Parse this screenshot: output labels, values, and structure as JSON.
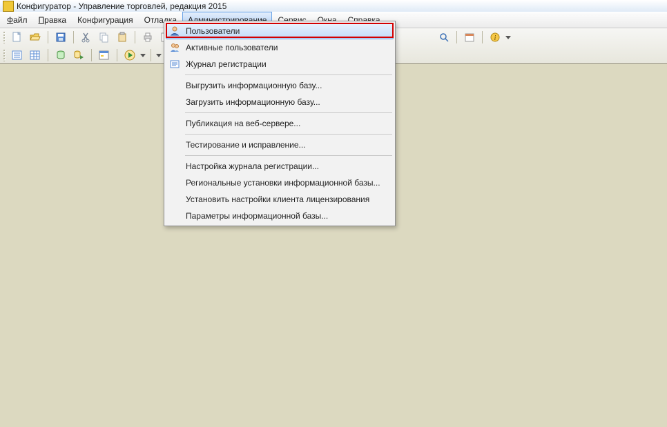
{
  "title": "Конфигуратор - Управление торговлей, редакция 2015",
  "menu": {
    "file": {
      "pre": "",
      "u": "Ф",
      "post": "айл"
    },
    "edit": {
      "pre": "",
      "u": "П",
      "post": "равка"
    },
    "config": "Конфигурация",
    "debug": "Отладка",
    "admin": {
      "pre": "",
      "u": "А",
      "post": "дминистрирование"
    },
    "service": {
      "pre": "",
      "u": "С",
      "post": "ервис"
    },
    "windows": {
      "pre": "",
      "u": "О",
      "post": "кна"
    },
    "help": {
      "pre": "Сп",
      "u": "р",
      "post": "авка"
    }
  },
  "dropdown": {
    "users": "Пользователи",
    "active_users": "Активные пользователи",
    "reg_log": "Журнал регистрации",
    "unload": "Выгрузить информационную базу...",
    "load": "Загрузить информационную базу...",
    "publish": "Публикация на веб-сервере...",
    "test": "Тестирование и исправление...",
    "log_settings": "Настройка журнала регистрации...",
    "regional": "Региональные установки информационной базы...",
    "licensing": "Установить настройки клиента лицензирования",
    "ib_params": "Параметры информационной базы..."
  }
}
